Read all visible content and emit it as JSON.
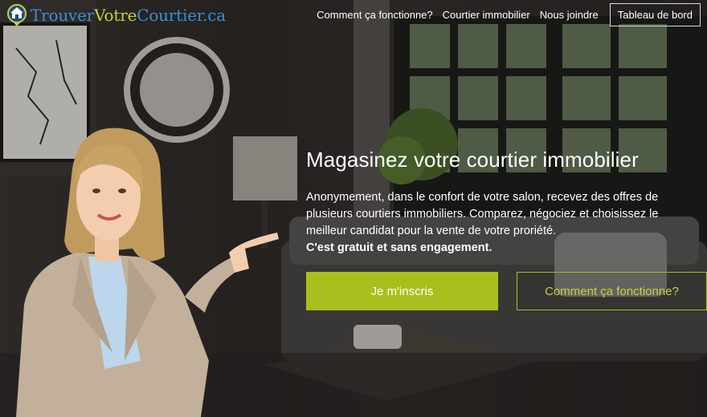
{
  "brand": {
    "name_part1": "Trouver",
    "name_part2": "Votre",
    "name_part3": "Courtier.ca",
    "colors": {
      "blue": "#3a8fd6",
      "green": "#c7d23c"
    }
  },
  "nav": {
    "items": [
      {
        "label": "Comment ça fonctionne?"
      },
      {
        "label": "Courtier immobilier"
      },
      {
        "label": "Nous joindre"
      }
    ],
    "cta_label": "Tableau de bord"
  },
  "hero": {
    "title": "Magasinez votre courtier immobilier",
    "description": "Anonymement, dans le confort de votre salon, recevez des offres de plusieurs courtiers immobiliers. Comparez, négociez et choisissez le meilleur candidat pour la vente de votre proriété.",
    "emphasis": "C'est gratuit et sans engagement.",
    "primary_button": "Je m'inscris",
    "secondary_button": "Comment ça fonctionne?",
    "accent_color": "#a9bf1d"
  },
  "icons": {
    "logo": "house-badge-icon"
  }
}
